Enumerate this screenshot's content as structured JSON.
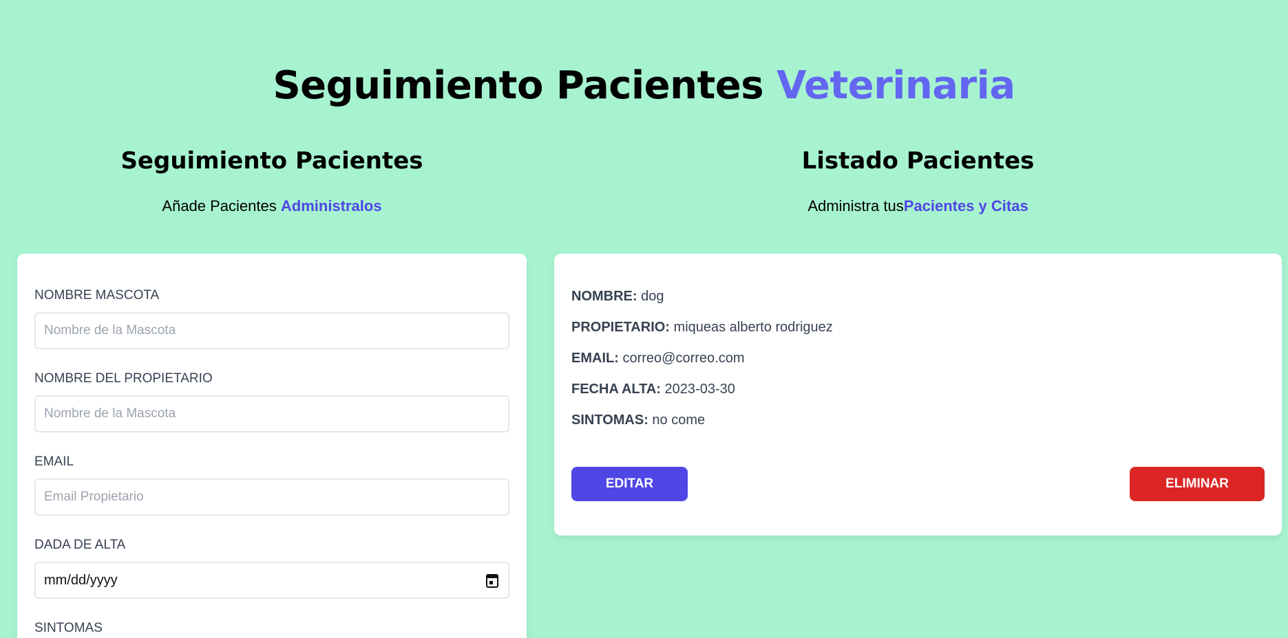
{
  "header": {
    "title_main": "Seguimiento Pacientes",
    "title_accent": "Veterinaria"
  },
  "form_section": {
    "title": "Seguimiento Pacientes",
    "subtitle_plain": "Añade Pacientes",
    "subtitle_accent": "Administralos",
    "fields": {
      "pet_name": {
        "label": "NOMBRE MASCOTA",
        "placeholder": "Nombre de la Mascota",
        "value": ""
      },
      "owner_name": {
        "label": "NOMBRE DEL PROPIETARIO",
        "placeholder": "Nombre de la Mascota",
        "value": ""
      },
      "email": {
        "label": "EMAIL",
        "placeholder": "Email Propietario",
        "value": ""
      },
      "discharge_date": {
        "label": "DADA DE ALTA",
        "value": "mm/dd/yyyy"
      },
      "symptoms": {
        "label": "SINTOMAS"
      }
    }
  },
  "list_section": {
    "title": "Listado Pacientes",
    "subtitle_plain": "Administra tus",
    "subtitle_accent": "Pacientes y Citas",
    "patients": [
      {
        "nombre_label": "NOMBRE:",
        "nombre": "dog",
        "propietario_label": "PROPIETARIO:",
        "propietario": "miqueas alberto rodriguez",
        "email_label": "EMAIL:",
        "email": "correo@correo.com",
        "fecha_label": "FECHA ALTA:",
        "fecha": "2023-03-30",
        "sintomas_label": "SINTOMAS:",
        "sintomas": "no come",
        "edit_label": "Editar",
        "delete_label": "Eliminar"
      }
    ]
  },
  "colors": {
    "background": "#a7f3d0",
    "accent": "#6366f1",
    "accent_dark": "#4f46e5",
    "danger": "#dc2626"
  }
}
